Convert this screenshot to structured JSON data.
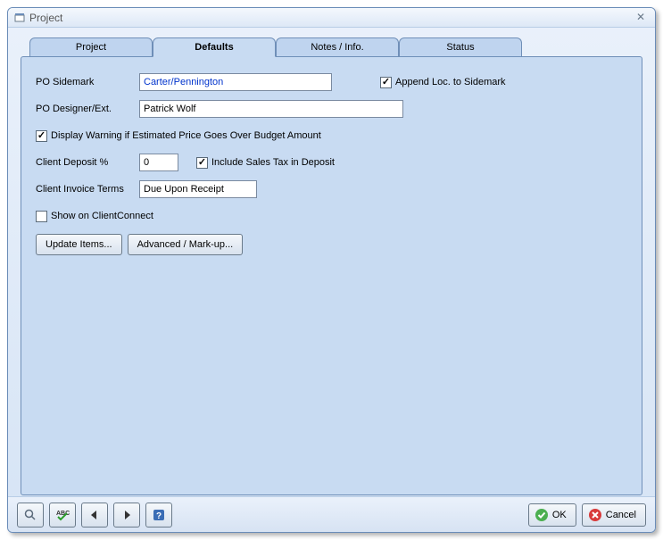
{
  "window": {
    "title": "Project",
    "close_glyph": "✕"
  },
  "tabs": {
    "project": "Project",
    "defaults": "Defaults",
    "notes": "Notes / Info.",
    "status": "Status"
  },
  "form": {
    "po_sidemark_label": "PO Sidemark",
    "po_sidemark_value": "Carter/Pennington",
    "append_loc_label": "Append Loc. to Sidemark",
    "append_loc_checked": "✓",
    "po_designer_label": "PO Designer/Ext.",
    "po_designer_value": "Patrick Wolf",
    "warning_label": "Display Warning if Estimated Price Goes Over Budget Amount",
    "warning_checked": "✓",
    "client_deposit_label": "Client Deposit %",
    "client_deposit_value": "0",
    "include_tax_label": "Include Sales Tax in Deposit",
    "include_tax_checked": "✓",
    "client_invoice_terms_label": "Client Invoice Terms",
    "client_invoice_terms_value": "Due Upon Receipt",
    "show_clientconnect_label": "Show on ClientConnect",
    "show_clientconnect_checked": "",
    "update_items_btn": "Update Items...",
    "advanced_btn": "Advanced / Mark-up..."
  },
  "footer": {
    "ok_label": "OK",
    "cancel_label": "Cancel"
  }
}
